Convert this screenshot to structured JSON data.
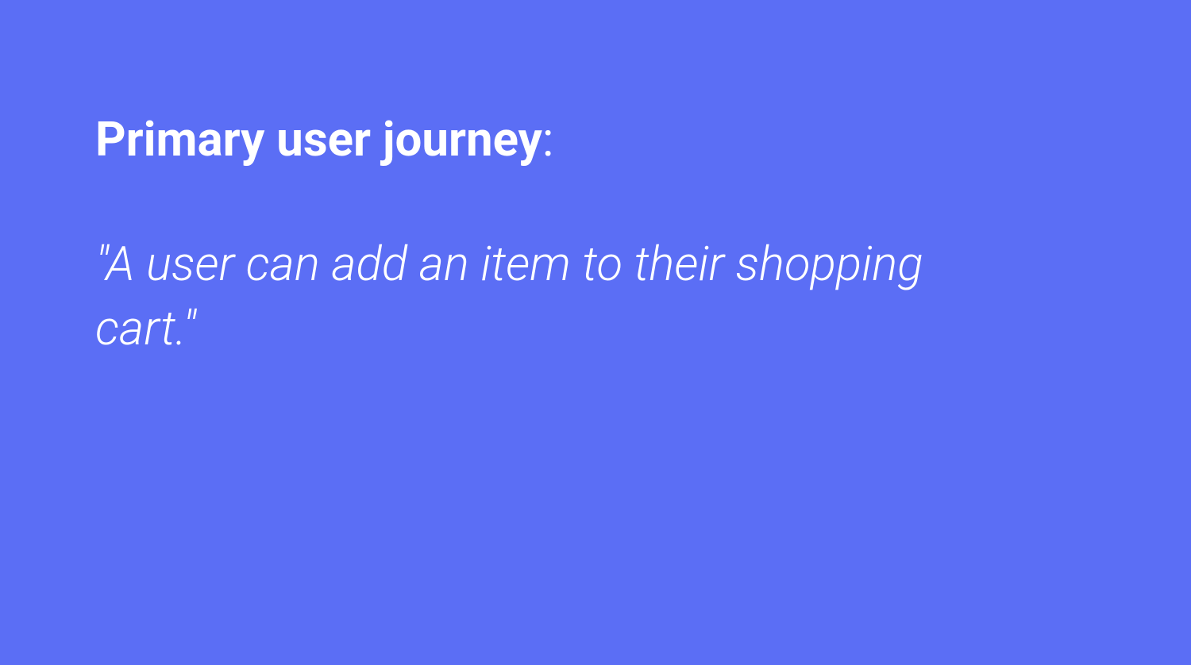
{
  "colors": {
    "background": "#5b6ef5",
    "text": "#ffffff"
  },
  "heading": {
    "label": "Primary user journey",
    "suffix": ":"
  },
  "quote": {
    "text": "\"A user can add an item to their shopping cart.\""
  }
}
